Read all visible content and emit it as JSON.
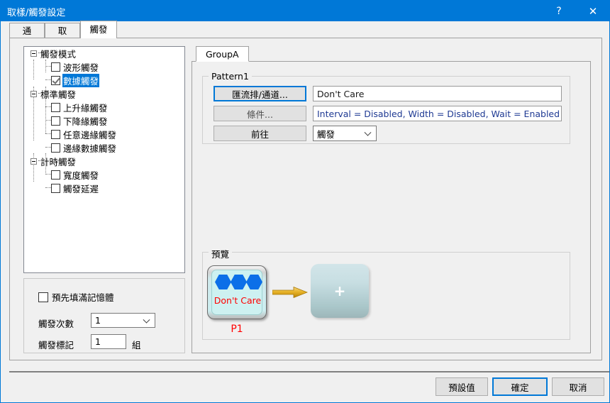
{
  "window": {
    "title": "取樣/觸發設定",
    "help_label": "?",
    "close_label": "✕",
    "accent_color": "#0078d7",
    "background_color": "#f0f0f0"
  },
  "tabs": [
    {
      "label": "通道",
      "selected": false
    },
    {
      "label": "取樣",
      "selected": false
    },
    {
      "label": "觸發",
      "selected": true
    }
  ],
  "tree": {
    "nodes": [
      {
        "label": "觸發模式",
        "level": 0,
        "type": "group",
        "checked": false,
        "selected": false
      },
      {
        "label": "波形觸發",
        "level": 1,
        "type": "checkbox",
        "checked": false,
        "selected": false
      },
      {
        "label": "數據觸發",
        "level": 1,
        "type": "checkbox",
        "checked": true,
        "selected": true
      },
      {
        "label": "標準觸發",
        "level": 0,
        "type": "group",
        "checked": false,
        "selected": false
      },
      {
        "label": "上升緣觸發",
        "level": 1,
        "type": "checkbox",
        "checked": false,
        "selected": false
      },
      {
        "label": "下降緣觸發",
        "level": 1,
        "type": "checkbox",
        "checked": false,
        "selected": false
      },
      {
        "label": "任意邊緣觸發",
        "level": 1,
        "type": "checkbox",
        "checked": false,
        "selected": false
      },
      {
        "label": "邊緣數據觸發",
        "level": 1,
        "type": "checkbox",
        "checked": false,
        "selected": false
      },
      {
        "label": "計時觸發",
        "level": 0,
        "type": "group",
        "checked": false,
        "selected": false
      },
      {
        "label": "寬度觸發",
        "level": 1,
        "type": "checkbox",
        "checked": false,
        "selected": false
      },
      {
        "label": "觸發延遲",
        "level": 1,
        "type": "checkbox",
        "checked": false,
        "selected": false
      }
    ]
  },
  "options": {
    "prefill_label": "預先填滿記憶體",
    "prefill_checked": false,
    "trigger_count_label": "觸發次數",
    "trigger_count_value": "1",
    "trigger_mark_label": "觸發標記",
    "trigger_mark_value": "1",
    "trigger_mark_unit": "組"
  },
  "group_tab": {
    "label": "GroupA"
  },
  "pattern": {
    "title": "Pattern1",
    "bus_channel_button": "匯流排/通道...",
    "bus_channel_value": "Don't Care",
    "condition_button": "條件...",
    "condition_value": "Interval = Disabled, Width = Disabled, Wait = Enabled",
    "goto_button": "前往",
    "goto_value": "觸發"
  },
  "preview": {
    "title": "預覽",
    "block1_text": "Don't Care",
    "block1_label": "P1",
    "block1_hex_count": 3,
    "block1_text_color": "#ff0000",
    "block1_hex_color": "#0c6fe8",
    "add_block_glyph": "+",
    "arrow_color": "#e0a411"
  },
  "footer": {
    "default_button": "預設值",
    "ok_button": "確定",
    "cancel_button": "取消"
  }
}
